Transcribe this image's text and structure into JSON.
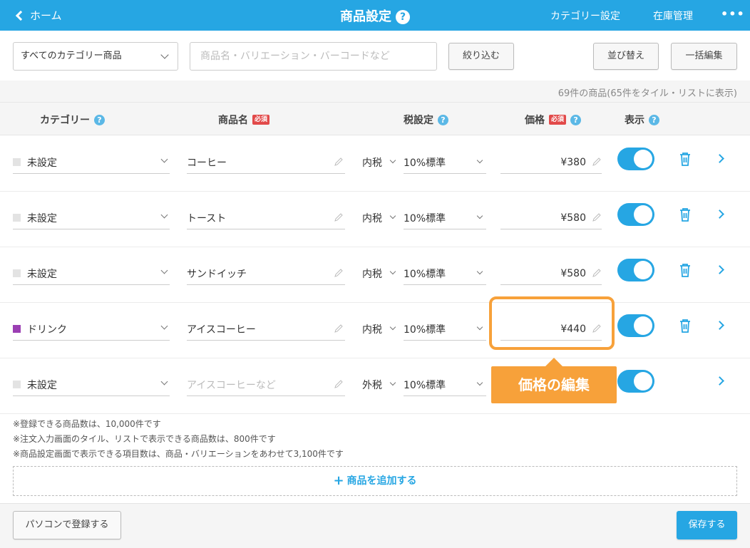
{
  "header": {
    "back_label": "ホーム",
    "title": "商品設定",
    "help": "?",
    "nav_category": "カテゴリー設定",
    "nav_stock": "在庫管理",
    "more": "•••"
  },
  "toolbar": {
    "category_select": "すべてのカテゴリー商品",
    "search_placeholder": "商品名・バリエーション・バーコードなど",
    "filter_label": "絞り込む",
    "sort_label": "並び替え",
    "bulk_label": "一括編集"
  },
  "count_text": "69件の商品(65件をタイル・リストに表示)",
  "columns": {
    "category": "カテゴリー",
    "name": "商品名",
    "tax": "税設定",
    "price": "価格",
    "display": "表示",
    "required": "必須",
    "help": "?"
  },
  "rows": [
    {
      "category": "未設定",
      "name": "コーヒー",
      "tax_type": "内税",
      "tax_rate": "10%標準",
      "price": "¥380",
      "visible": true
    },
    {
      "category": "未設定",
      "name": "トースト",
      "tax_type": "内税",
      "tax_rate": "10%標準",
      "price": "¥580",
      "visible": true
    },
    {
      "category": "未設定",
      "name": "サンドイッチ",
      "tax_type": "内税",
      "tax_rate": "10%標準",
      "price": "¥580",
      "visible": true
    },
    {
      "category": "ドリンク",
      "name": "アイスコーヒー",
      "tax_type": "内税",
      "tax_rate": "10%標準",
      "price": "¥440",
      "visible": true
    },
    {
      "category": "未設定",
      "name_placeholder": "アイスコーヒーなど",
      "tax_type": "外税",
      "tax_rate": "10%標準",
      "visible": true
    }
  ],
  "colors": {
    "accent": "#26a6e3",
    "callout": "#f7a13a",
    "drink_swatch": "#9b3fb3",
    "unset_swatch": "#e3e3e3",
    "required": "#e24a4a"
  },
  "callout_label": "価格の編集",
  "notes": [
    "※登録できる商品数は、10,000件です",
    "※注文入力画面のタイル、リストで表示できる商品数は、800件です",
    "※商品設定画面で表示できる項目数は、商品・バリエーションをあわせて3,100件です"
  ],
  "add_label": "商品を追加する",
  "footer": {
    "pc_label": "パソコンで登録する",
    "save_label": "保存する"
  }
}
